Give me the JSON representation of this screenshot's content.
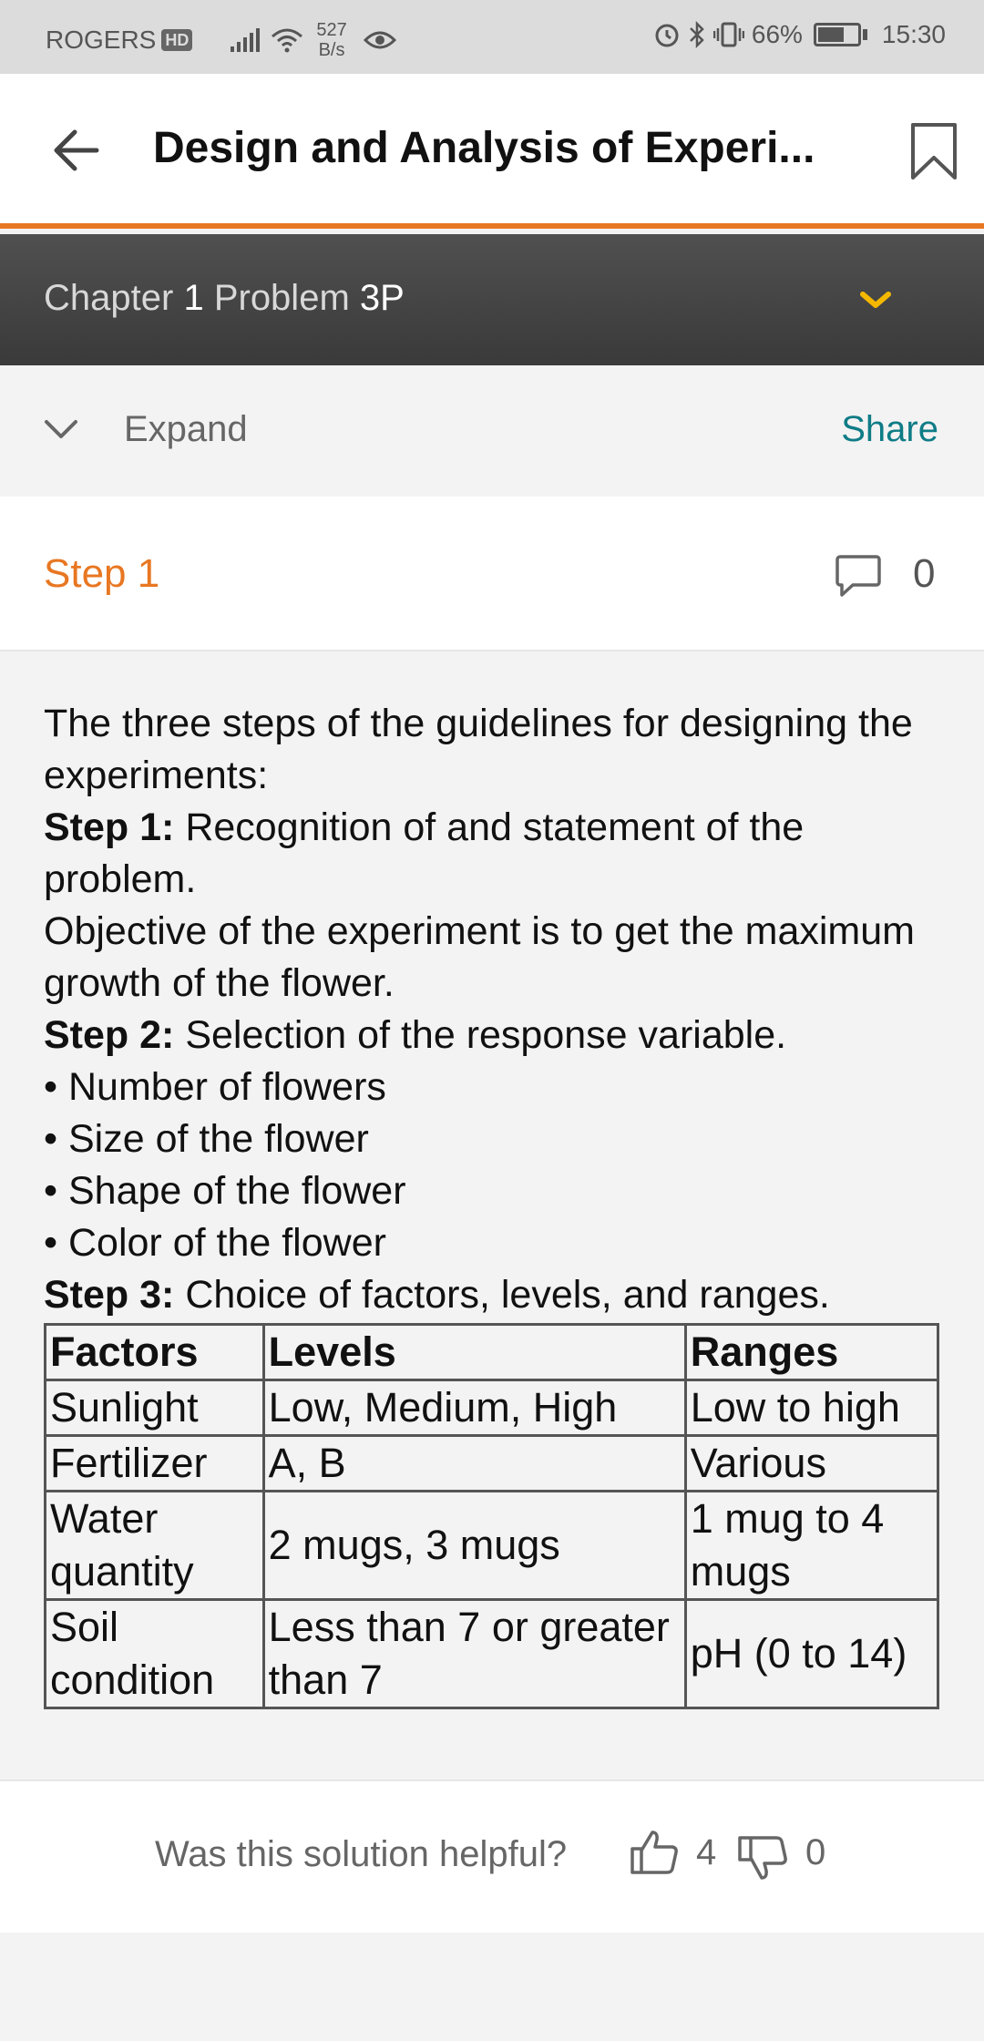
{
  "status_bar": {
    "carrier": "ROGERS",
    "hd": "HD",
    "speed_value": "527",
    "speed_unit": "B/s",
    "battery": "66%",
    "battery_level": 0.66,
    "time": "15:30"
  },
  "header": {
    "title": "Design and Analysis of Experi..."
  },
  "chapter_bar": {
    "chapter_label": "Chapter",
    "chapter_number": "1",
    "problem_label": "Problem",
    "problem_number": "3P"
  },
  "expand_row": {
    "expand_label": "Expand",
    "share_label": "Share"
  },
  "step": {
    "title": "Step 1",
    "comment_count": "0"
  },
  "content": {
    "intro": "The three steps of the guidelines for designing the experiments:",
    "step1_label": "Step 1:",
    "step1_text": " Recognition of and statement of the problem.",
    "objective": "Objective of the experiment is to get the maximum growth of the flower.",
    "step2_label": "Step 2:",
    "step2_text": " Selection of the response variable.",
    "bullets": [
      "• Number of flowers",
      "• Size of the flower",
      "• Shape of the flower",
      "• Color of the flower"
    ],
    "step3_label": "Step 3:",
    "step3_text": " Choice of factors, levels, and ranges.",
    "table": {
      "headers": [
        "Factors",
        "Levels",
        "Ranges"
      ],
      "rows": [
        [
          "Sunlight",
          "Low, Medium, High",
          "Low to high"
        ],
        [
          "Fertilizer",
          "A, B",
          "Various"
        ],
        [
          "Water quantity",
          "2 mugs, 3 mugs",
          "1 mug to 4 mugs"
        ],
        [
          "Soil condition",
          "Less than 7 or greater than 7",
          "pH (0 to 14)"
        ]
      ]
    }
  },
  "footer": {
    "helpful_question": "Was this solution helpful?",
    "thumbs_up_count": "4",
    "thumbs_down_count": "0"
  },
  "colors": {
    "accent_orange": "#e87722",
    "share_teal": "#0e7c86",
    "chevron_yellow": "#f5b800"
  }
}
